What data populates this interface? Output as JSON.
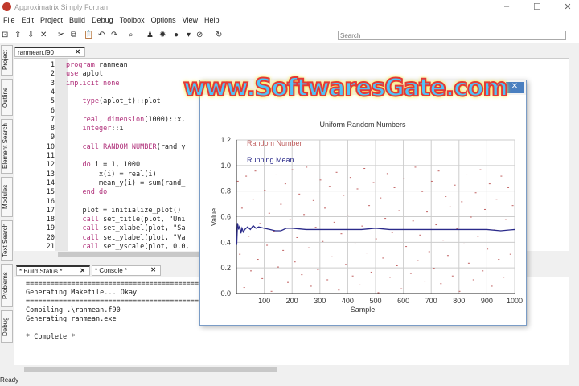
{
  "app": {
    "title": "Approximatrix Simply Fortran",
    "window_controls": [
      "minimize-icon",
      "maximize-icon",
      "close-icon"
    ]
  },
  "menu": [
    "File",
    "Edit",
    "Project",
    "Build",
    "Debug",
    "Toolbox",
    "Options",
    "View",
    "Help"
  ],
  "toolbar": {
    "search_placeholder": "Search",
    "icons": [
      "new-file-icon",
      "open-icon",
      "save-icon",
      "close-icon",
      "cut-icon",
      "copy-icon",
      "paste-icon",
      "undo-icon",
      "redo-icon",
      "find-icon",
      "build-icon",
      "gear-icon",
      "run-icon",
      "dropdown-icon",
      "stop-icon",
      "refresh-icon"
    ]
  },
  "side_tabs": [
    "Project",
    "Outline",
    "Element Search",
    "Modules",
    "Text Search",
    "Problems",
    "Debug"
  ],
  "editor": {
    "tab": "ranmean.f90",
    "lines": [
      {
        "n": "1",
        "text": "program ranmean",
        "kw": "program"
      },
      {
        "n": "2",
        "text": "use aplot",
        "kw": "use"
      },
      {
        "n": "3",
        "text": "implicit none",
        "kw": "implicit none"
      },
      {
        "n": "4",
        "text": ""
      },
      {
        "n": "5",
        "text": "    type(aplot_t)::plot",
        "kw": "type"
      },
      {
        "n": "6",
        "text": ""
      },
      {
        "n": "7",
        "text": "    real, dimension(1000)::x,",
        "kw": "real, dimension"
      },
      {
        "n": "8",
        "text": "    integer::i",
        "kw": "integer"
      },
      {
        "n": "9",
        "text": ""
      },
      {
        "n": "10",
        "text": "    call RANDOM_NUMBER(rand_y",
        "kw": "call RANDOM_NUMBER"
      },
      {
        "n": "11",
        "text": ""
      },
      {
        "n": "12",
        "text": "    do i = 1, 1000",
        "kw": "do"
      },
      {
        "n": "13",
        "text": "        x(i) = real(i)"
      },
      {
        "n": "14",
        "text": "        mean_y(i) = sum(rand_"
      },
      {
        "n": "15",
        "text": "    end do",
        "kw": "end do"
      },
      {
        "n": "16",
        "text": ""
      },
      {
        "n": "17",
        "text": "    plot = initialize_plot()"
      },
      {
        "n": "18",
        "text": "    call set_title(plot, \"Uni",
        "kw": "call"
      },
      {
        "n": "19",
        "text": "    call set_xlabel(plot, \"Sa",
        "kw": "call"
      },
      {
        "n": "20",
        "text": "    call set_ylabel(plot, \"Va",
        "kw": "call"
      },
      {
        "n": "21",
        "text": "    call set_yscale(plot, 0.0,",
        "kw": "call"
      }
    ]
  },
  "bottom_tabs": [
    "* Build Status *",
    "* Console *"
  ],
  "console": [
    "==============================================================",
    "Generating Makefile... Okay",
    "==============================================================",
    "Compiling .\\ranmean.f90",
    "Generating ranmean.exe",
    "",
    "* Complete *"
  ],
  "status": "Ready",
  "watermark": "www.SoftwaresGate.com",
  "chart_data": {
    "type": "scatter",
    "title": "Uniform Random Numbers",
    "xlabel": "Sample",
    "ylabel": "Value",
    "xlim": [
      0,
      1000
    ],
    "ylim": [
      0,
      1.2
    ],
    "xticks": [
      "100",
      "200",
      "300",
      "400",
      "500",
      "600",
      "700",
      "800",
      "900",
      "1000"
    ],
    "yticks": [
      "0.0",
      "0.2",
      "0.4",
      "0.6",
      "0.8",
      "1.0",
      "1.2"
    ],
    "grid": true,
    "legend": "top-left",
    "colors": {
      "random": "#c06060",
      "mean": "#2a2a8a"
    },
    "series": [
      {
        "name": "Random Number",
        "style": "points",
        "x": [
          5,
          12,
          20,
          28,
          35,
          44,
          52,
          60,
          68,
          77,
          85,
          93,
          102,
          110,
          118,
          126,
          135,
          143,
          150,
          160,
          168,
          176,
          185,
          193,
          201,
          210,
          218,
          226,
          235,
          243,
          252,
          260,
          268,
          277,
          285,
          293,
          302,
          310,
          318,
          327,
          335,
          343,
          352,
          360,
          368,
          377,
          385,
          393,
          402,
          410,
          418,
          427,
          435,
          443,
          452,
          460,
          468,
          477,
          485,
          493,
          502,
          510,
          518,
          527,
          535,
          543,
          552,
          560,
          568,
          577,
          585,
          593,
          602,
          610,
          618,
          627,
          635,
          643,
          652,
          660,
          668,
          677,
          685,
          693,
          702,
          710,
          718,
          727,
          735,
          743,
          752,
          760,
          768,
          777,
          785,
          793,
          802,
          810,
          818,
          827,
          835,
          843,
          852,
          860,
          868,
          877,
          885,
          893,
          902,
          910,
          918,
          927,
          935,
          943,
          952,
          960,
          968,
          977,
          985,
          993
        ],
        "y": [
          0.88,
          0.31,
          0.67,
          0.05,
          0.92,
          0.45,
          0.18,
          0.74,
          0.96,
          0.27,
          0.55,
          0.12,
          0.81,
          0.38,
          0.63,
          0.02,
          0.49,
          0.93,
          0.21,
          0.7,
          0.34,
          0.86,
          0.09,
          0.58,
          0.97,
          0.25,
          0.44,
          0.78,
          0.15,
          0.62,
          0.99,
          0.36,
          0.06,
          0.73,
          0.52,
          0.19,
          0.89,
          0.41,
          0.67,
          0.11,
          0.84,
          0.29,
          0.56,
          0.95,
          0.03,
          0.47,
          0.77,
          0.23,
          0.61,
          0.91,
          0.14,
          0.39,
          0.82,
          0.07,
          0.53,
          0.98,
          0.32,
          0.69,
          0.17,
          0.87,
          0.43,
          0.01,
          0.75,
          0.28,
          0.59,
          0.94,
          0.13,
          0.48,
          0.83,
          0.22,
          0.65,
          0.04,
          0.9,
          0.37,
          0.71,
          0.16,
          0.57,
          0.99,
          0.26,
          0.46,
          0.8,
          0.1,
          0.64,
          0.33,
          0.88,
          0.2,
          0.54,
          0.96,
          0.08,
          0.42,
          0.76,
          0.3,
          0.68,
          0.14,
          0.85,
          0.51,
          0.02,
          0.72,
          0.39,
          0.93,
          0.24,
          0.6,
          0.11,
          0.79,
          0.45,
          0.97,
          0.18,
          0.66,
          0.35,
          0.86,
          0.06,
          0.5,
          0.74,
          0.27,
          0.92,
          0.13,
          0.58,
          0.83,
          0.31,
          0.69
        ]
      },
      {
        "name": "Running Mean",
        "style": "line",
        "x": [
          1,
          4,
          8,
          12,
          16,
          20,
          25,
          30,
          40,
          50,
          60,
          70,
          80,
          100,
          120,
          140,
          160,
          180,
          200,
          250,
          300,
          350,
          400,
          450,
          500,
          550,
          600,
          650,
          700,
          750,
          800,
          850,
          900,
          950,
          1000
        ],
        "y": [
          0.38,
          0.55,
          0.5,
          0.53,
          0.47,
          0.51,
          0.48,
          0.5,
          0.52,
          0.5,
          0.53,
          0.51,
          0.52,
          0.51,
          0.5,
          0.49,
          0.49,
          0.51,
          0.51,
          0.5,
          0.5,
          0.5,
          0.5,
          0.5,
          0.51,
          0.5,
          0.5,
          0.5,
          0.5,
          0.5,
          0.5,
          0.5,
          0.5,
          0.49,
          0.5
        ]
      }
    ]
  }
}
